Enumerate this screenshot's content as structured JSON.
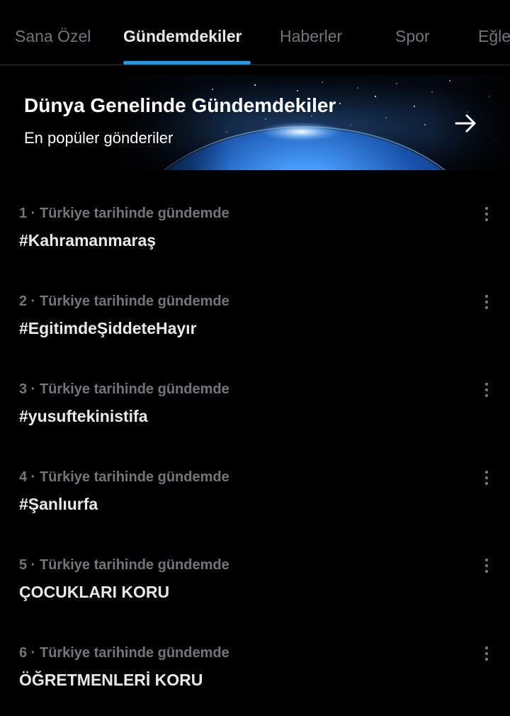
{
  "tabs": [
    {
      "label": "Sana Özel",
      "active": false
    },
    {
      "label": "Gündemdekiler",
      "active": true
    },
    {
      "label": "Haberler",
      "active": false
    },
    {
      "label": "Spor",
      "active": false
    },
    {
      "label": "Eğle",
      "active": false
    }
  ],
  "banner": {
    "title": "Dünya Genelinde Gündemdekiler",
    "subtitle": "En popüler gönderiler",
    "arrow_icon": "arrow-right-icon",
    "image": "earth-from-space"
  },
  "trends": [
    {
      "meta": "1 · Türkiye tarihinde gündemde",
      "title": "#Kahramanmaraş"
    },
    {
      "meta": "2 · Türkiye tarihinde gündemde",
      "title": "#EgitimdeŞiddeteHayır"
    },
    {
      "meta": "3 · Türkiye tarihinde gündemde",
      "title": "#yusuftekinistifa"
    },
    {
      "meta": "4 · Türkiye tarihinde gündemde",
      "title": "#Şanlıurfa"
    },
    {
      "meta": "5 · Türkiye tarihinde gündemde",
      "title": "ÇOCUKLARI KORU"
    },
    {
      "meta": "6 · Türkiye tarihinde gündemde",
      "title": "ÖĞRETMENLERİ KORU"
    }
  ],
  "colors": {
    "background": "#000000",
    "accent": "#1d9bf0",
    "text_primary": "#e7e9ea",
    "text_secondary": "#71767b",
    "divider": "#2f3336"
  }
}
